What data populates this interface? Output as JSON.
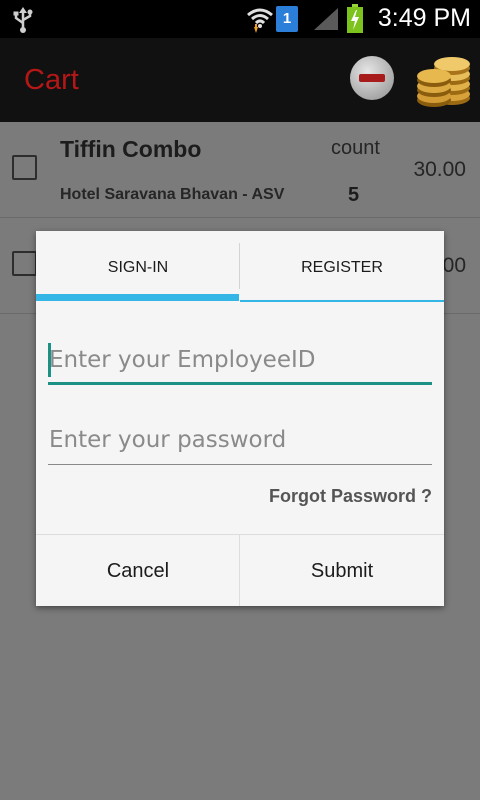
{
  "status_bar": {
    "time": "3:49 PM",
    "sim_slot": "1",
    "icons": [
      "usb-icon",
      "wifi-icon",
      "sim-icon",
      "signal-icon",
      "battery-charging-icon"
    ]
  },
  "action_bar": {
    "title": "Cart",
    "title_color": "#b51717",
    "actions": [
      "remove-icon",
      "coins-icon"
    ]
  },
  "cart": {
    "items": [
      {
        "name": "Tiffin Combo",
        "hotel": "Hotel Saravana Bhavan - ASV",
        "count_label": "count",
        "count": "5",
        "price": "30.00"
      },
      {
        "price_partial": "00"
      }
    ]
  },
  "dialog": {
    "tabs": [
      {
        "label": "SIGN-IN",
        "active": true
      },
      {
        "label": "REGISTER",
        "active": false
      }
    ],
    "employee_id": {
      "placeholder": "Enter your EmployeeID",
      "value": ""
    },
    "password": {
      "placeholder": "Enter your password",
      "value": ""
    },
    "forgot_label": "Forgot Password ?",
    "cancel_label": "Cancel",
    "submit_label": "Submit",
    "accent_color": "#33b5e5",
    "focus_color": "#1b9184"
  }
}
